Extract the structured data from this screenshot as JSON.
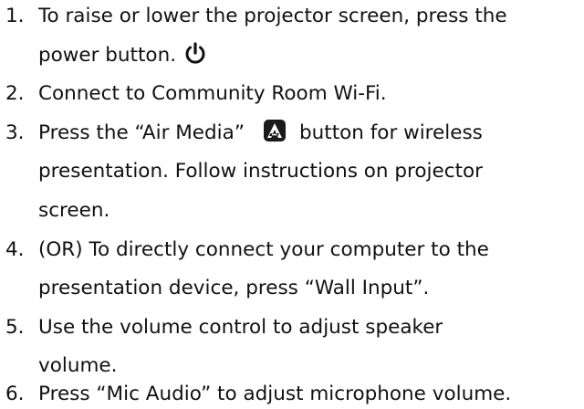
{
  "items": [
    {
      "number": "1.",
      "lines": [
        "To raise or lower the projector screen, press the",
        "power button."
      ],
      "icon": "power-icon"
    },
    {
      "number": "2.",
      "lines": [
        "Connect to Community Room Wi-Fi."
      ]
    },
    {
      "number": "3.",
      "line1_before_icon": "Press the “Air Media”",
      "line1_after_icon": "button for wireless",
      "icon": "air-media-icon",
      "lines": [
        "presentation. Follow instructions on projector",
        "screen."
      ]
    },
    {
      "number": "4.",
      "lines": [
        "(OR) To directly connect your computer to the",
        "presentation device, press “Wall Input”."
      ]
    },
    {
      "number": "5.",
      "lines": [
        "Use the volume control to adjust speaker",
        "volume."
      ]
    },
    {
      "number": "6.",
      "lines": [
        "Press “Mic Audio” to adjust microphone volume."
      ]
    }
  ]
}
